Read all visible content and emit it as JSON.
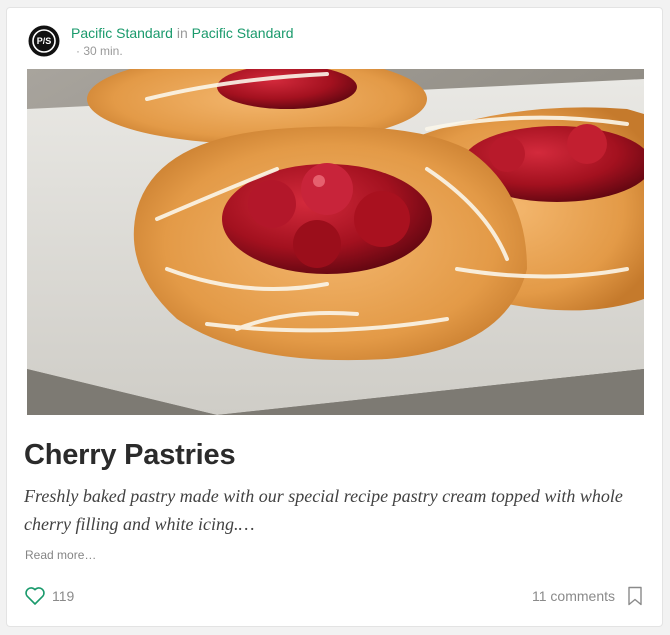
{
  "post": {
    "author": "Pacific Standard",
    "in_word": "in",
    "publication": "Pacific Standard",
    "avatar_text": "P/S",
    "read_time": "· 30 min.",
    "title": "Cherry Pastries",
    "description": "Freshly baked pastry made with our special recipe pastry cream topped with whole cherry filling and white icing.…",
    "read_more": "Read more…",
    "likes": "119",
    "comments": "11 comments"
  },
  "colors": {
    "accent": "#1a9a6c",
    "text_dark": "#2b2b2b",
    "muted": "#8a8a8a"
  },
  "icons": {
    "like": "heart-icon",
    "bookmark": "bookmark-icon"
  }
}
